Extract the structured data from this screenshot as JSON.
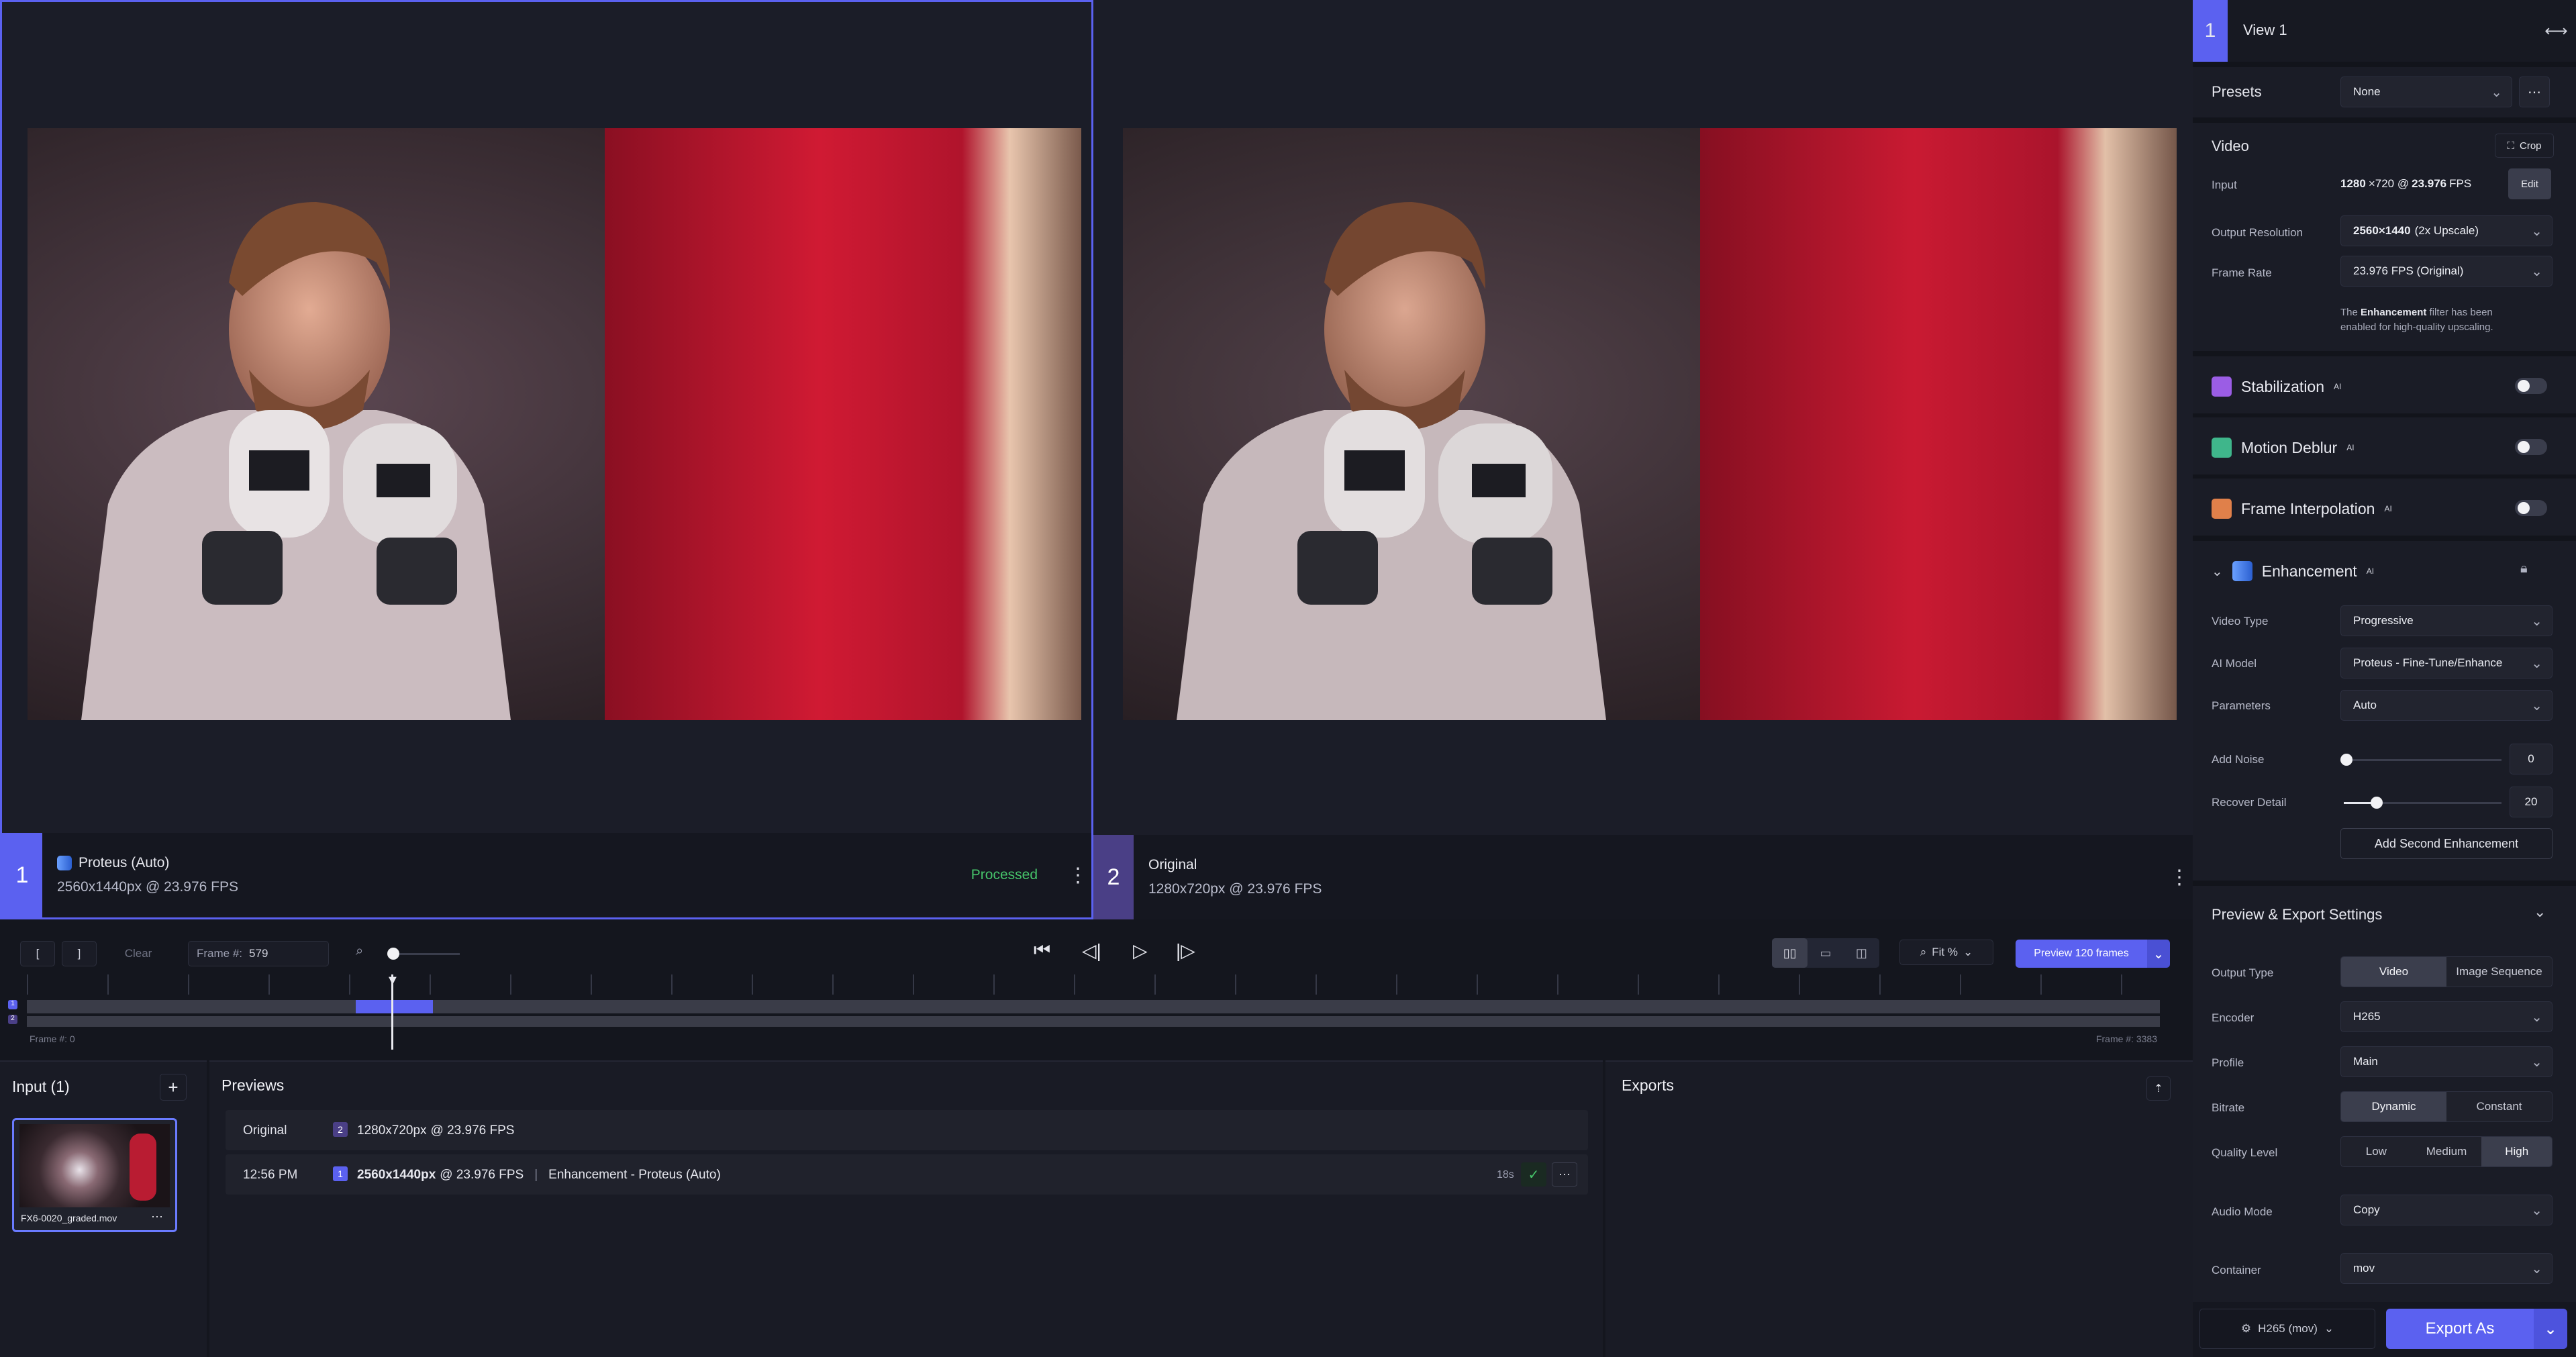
{
  "viewer": {
    "left": {
      "number": "1",
      "model_label": "Proteus (Auto)",
      "resolution": "2560x1440px @ 23.976 FPS",
      "status": "Processed"
    },
    "right": {
      "number": "2",
      "model_label": "Original",
      "resolution": "1280x720px @ 23.976 FPS"
    }
  },
  "transport": {
    "mark_in": "[",
    "mark_out": "]",
    "clear_label": "Clear",
    "frame_label": "Frame #:",
    "frame_value": "579",
    "zoom_fit": "Fit %",
    "preview_button": "Preview 120 frames",
    "timeline_start": "Frame #: 0",
    "timeline_end": "Frame #: 3383",
    "timeline_position_fraction": 0.171,
    "track_labels": [
      "1",
      "2"
    ]
  },
  "input_panel": {
    "title": "Input (1)",
    "add_icon": "plus-icon",
    "file_name": "FX6-0020_graded.mov"
  },
  "previews_panel": {
    "title": "Previews",
    "rows": [
      {
        "time": "Original",
        "badge": "2",
        "resolution": "1280x720px",
        "fps": "@ 23.976 FPS",
        "desc": ""
      },
      {
        "time": "12:56 PM",
        "badge": "1",
        "resolution": "2560x1440px",
        "fps": "@ 23.976 FPS",
        "desc": "Enhancement - Proteus (Auto)",
        "duration": "18s"
      }
    ]
  },
  "exports_panel": {
    "title": "Exports"
  },
  "sidebar": {
    "view_number": "1",
    "view_title": "View 1",
    "presets_label": "Presets",
    "presets_value": "None",
    "video": {
      "title": "Video",
      "crop_label": "Crop",
      "input_label": "Input",
      "input_value_bold": "1280",
      "input_value_rest": "×720 @",
      "input_fps_bold": "23.976",
      "input_fps_rest": "FPS",
      "edit_label": "Edit",
      "output_res_label": "Output Resolution",
      "output_res_value_bold": "2560×1440",
      "output_res_value_rest": "(2x Upscale)",
      "frame_rate_label": "Frame Rate",
      "frame_rate_value": "23.976 FPS (Original)",
      "note_pre": "The ",
      "note_bold": "Enhancement",
      "note_post": " filter has been",
      "note_line2": "enabled for high-quality upscaling."
    },
    "features": [
      {
        "name": "Stabilization",
        "tag": "AI",
        "enabled": false,
        "color": "#9b5de5"
      },
      {
        "name": "Motion Deblur",
        "tag": "AI",
        "enabled": false,
        "color": "#3fb68b"
      },
      {
        "name": "Frame Interpolation",
        "tag": "AI",
        "enabled": false,
        "color": "#e0804a"
      }
    ],
    "enhancement": {
      "title": "Enhancement",
      "tag": "AI",
      "video_type_label": "Video Type",
      "video_type_value": "Progressive",
      "ai_model_label": "AI Model",
      "ai_model_value": "Proteus - Fine-Tune/Enhance",
      "parameters_label": "Parameters",
      "parameters_value": "Auto",
      "add_noise_label": "Add Noise",
      "add_noise_value": "0",
      "recover_detail_label": "Recover Detail",
      "recover_detail_value": "20",
      "second_button": "Add Second Enhancement"
    },
    "export_settings": {
      "title": "Preview & Export Settings",
      "output_type_label": "Output Type",
      "output_type_options": [
        "Video",
        "Image Sequence"
      ],
      "output_type_selected": "Video",
      "encoder_label": "Encoder",
      "encoder_value": "H265",
      "profile_label": "Profile",
      "profile_value": "Main",
      "bitrate_label": "Bitrate",
      "bitrate_options": [
        "Dynamic",
        "Constant"
      ],
      "bitrate_selected": "Dynamic",
      "quality_label": "Quality Level",
      "quality_options": [
        "Low",
        "Medium",
        "High"
      ],
      "quality_selected": "High",
      "audio_label": "Audio Mode",
      "audio_value": "Copy",
      "container_label": "Container",
      "container_value": "mov"
    },
    "footer": {
      "format_label": "H265 (mov)",
      "export_label": "Export As"
    }
  },
  "colors": {
    "accent": "#5b61f0",
    "processed": "#46c46a",
    "panel": "#1a1c26",
    "background": "#14161e"
  }
}
